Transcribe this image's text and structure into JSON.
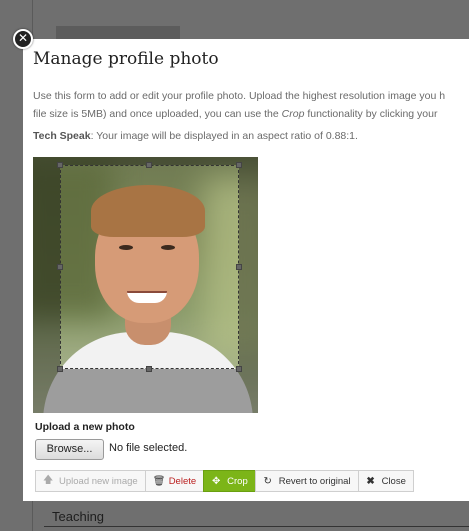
{
  "background": {
    "teaching_label": "Teaching"
  },
  "modal": {
    "title": "Manage profile photo",
    "close_glyph": "✕",
    "description_1": "Use this form to add or edit your profile photo. Upload the highest resolution image you h",
    "description_2a": "file size is 5MB) and once uploaded, you can use the ",
    "description_2_em": "Crop",
    "description_2b": " functionality by clicking your",
    "tech_label": "Tech Speak",
    "tech_text": ": Your image will be displayed in an aspect ratio of 0.88:1.",
    "upload_label": "Upload a new photo",
    "browse_label": "Browse...",
    "no_file_text": "No file selected.",
    "toolbar": {
      "upload_label": "Upload new image",
      "delete_label": "Delete",
      "crop_label": "Crop",
      "revert_label": "Revert to original",
      "close_label": "Close"
    },
    "icons": {
      "upload": "arrow-up-icon",
      "delete": "trash-icon",
      "crop": "crop-move-icon",
      "revert": "revert-icon",
      "close": "close-x-icon"
    },
    "colors": {
      "crop_button": "#7cb518",
      "delete_text": "#b22222"
    }
  }
}
